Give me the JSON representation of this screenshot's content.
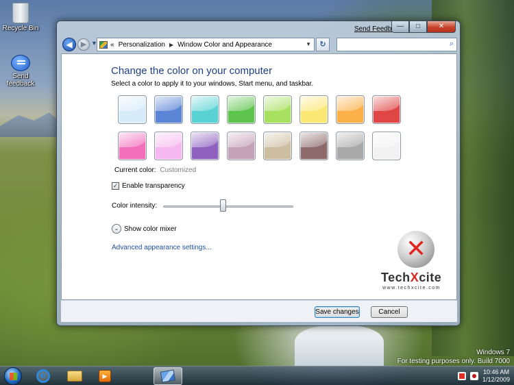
{
  "desktop": {
    "icons": [
      {
        "label": "Recycle Bin"
      },
      {
        "label": "Send feedback"
      }
    ],
    "watermark": {
      "line1": "Windows 7",
      "line2": "For testing purposes only. Build 7000"
    }
  },
  "window": {
    "titlebar_link": "Send Feedback",
    "caption": {
      "minimize": "—",
      "maximize": "□",
      "close": "✕"
    },
    "address": {
      "chevron": "«",
      "crumb1": "Personalization",
      "separator": "▶",
      "crumb2": "Window Color and Appearance"
    },
    "search": {
      "placeholder": ""
    },
    "heading": "Change the color on your computer",
    "subtext": "Select a color to apply it to your windows, Start menu, and taskbar.",
    "swatches": [
      {
        "color": "#d7ecfb"
      },
      {
        "color": "#5a84d6"
      },
      {
        "color": "#59d2d4"
      },
      {
        "color": "#5fc44e"
      },
      {
        "color": "#a8e060"
      },
      {
        "color": "#fbe773"
      },
      {
        "color": "#fbb04a"
      },
      {
        "color": "#e04646"
      },
      {
        "color": "#f36fbc"
      },
      {
        "color": "#f7b8f0"
      },
      {
        "color": "#8e61bf"
      },
      {
        "color": "#c4a2b7"
      },
      {
        "color": "#cdbda1"
      },
      {
        "color": "#8c6a6a"
      },
      {
        "color": "#a9a9a9"
      },
      {
        "color": "#f2f2f2"
      }
    ],
    "current_color": {
      "label": "Current color:",
      "value": "Customized"
    },
    "transparency": {
      "label": "Enable transparency",
      "checked": true
    },
    "intensity": {
      "label": "Color intensity:",
      "value_percent": 46
    },
    "mixer_label": "Show color mixer",
    "advanced_link": "Advanced appearance settings...",
    "logo": {
      "name": "TechXcite",
      "url": "www.techxcite.com"
    },
    "buttons": {
      "save": "Save changes",
      "cancel": "Cancel"
    }
  },
  "taskbar": {
    "clock_time": "10:46 AM",
    "clock_date": "1/12/2009"
  }
}
